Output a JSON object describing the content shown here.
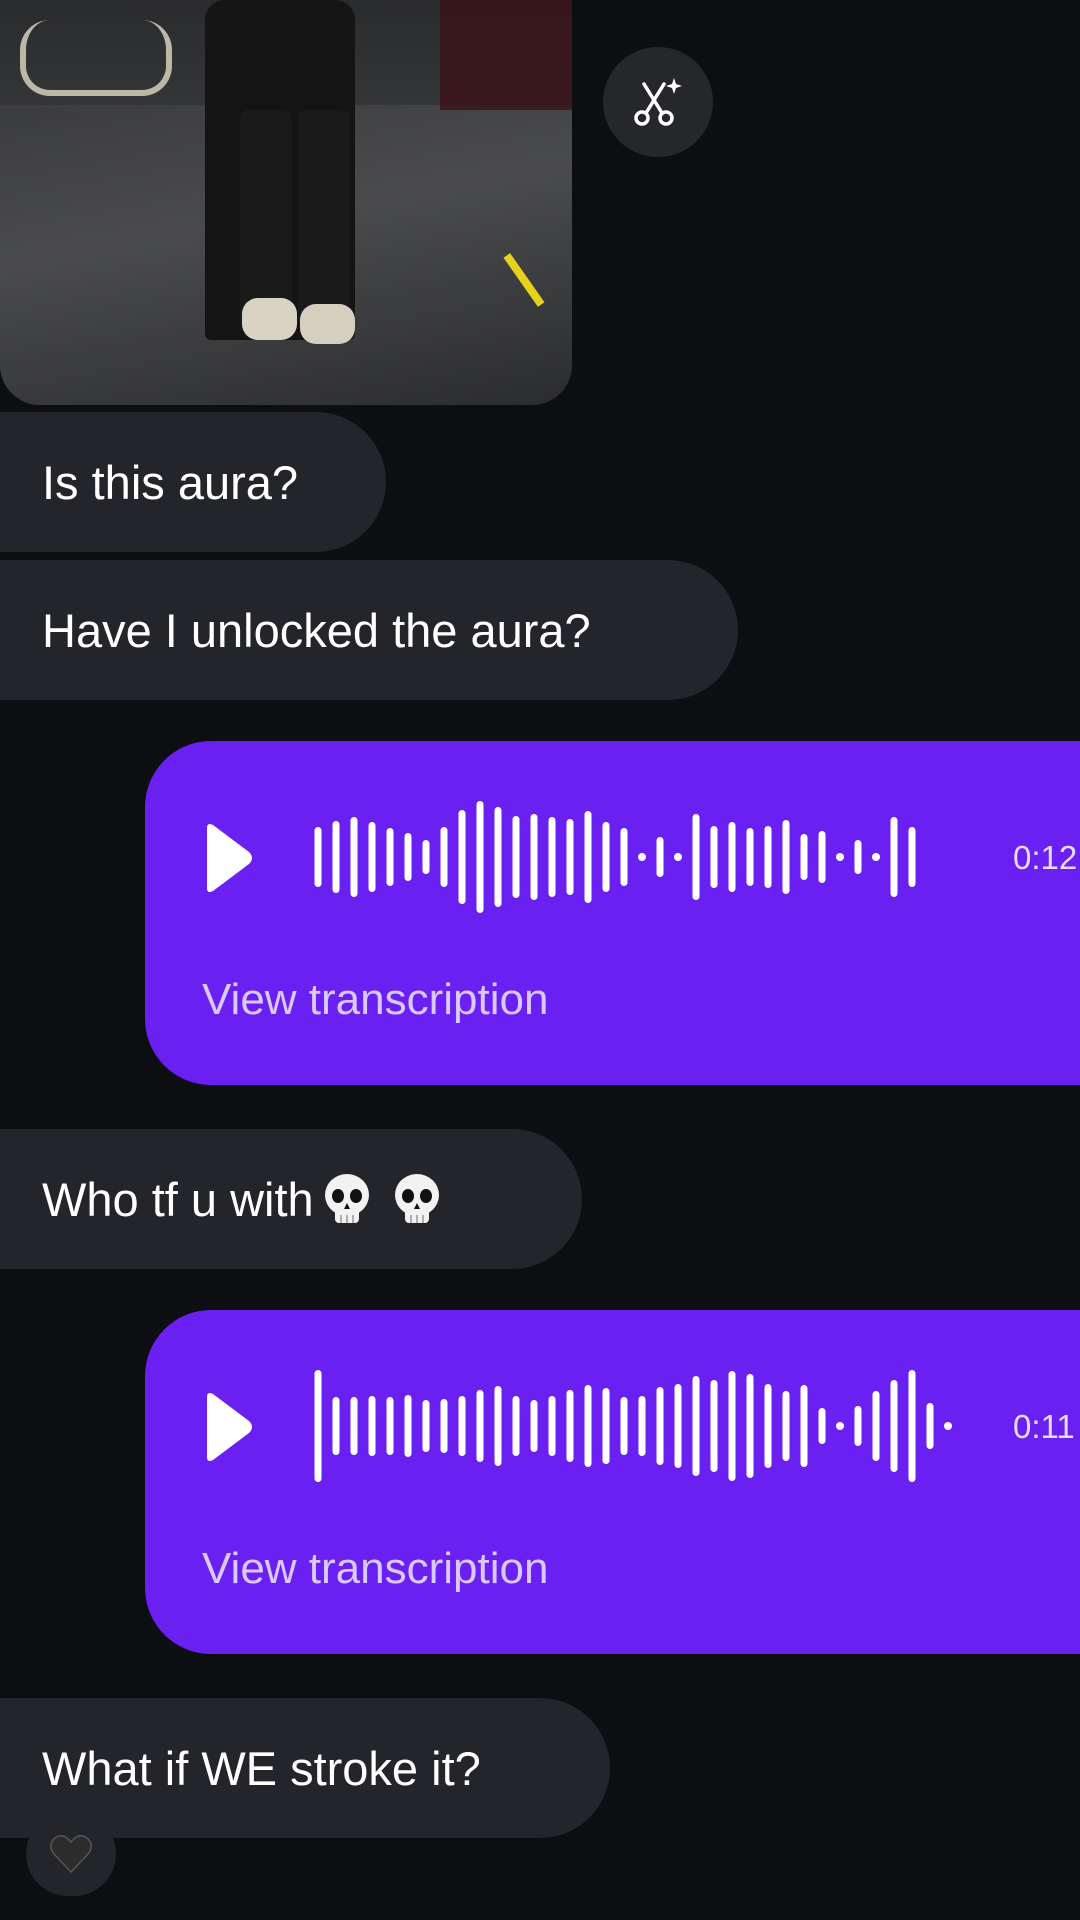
{
  "messages": [
    {
      "text": "Is this aura?"
    },
    {
      "text": "Have I unlocked the aura?"
    },
    {
      "text": "Who tf u with"
    },
    {
      "text": "What if WE stroke it?"
    }
  ],
  "voice_notes": [
    {
      "duration": "0:12",
      "transcription_label": "View transcription"
    },
    {
      "duration": "0:11",
      "transcription_label": "View transcription"
    }
  ],
  "icons": {
    "effect": "scissors-sparkle-icon",
    "play": "play-icon",
    "emoji": "skull-emoji",
    "reaction": "black-heart-icon"
  },
  "colors": {
    "background": "#0c0e12",
    "incoming_bubble": "#23252a",
    "voice_bubble": "#6b20f2"
  }
}
